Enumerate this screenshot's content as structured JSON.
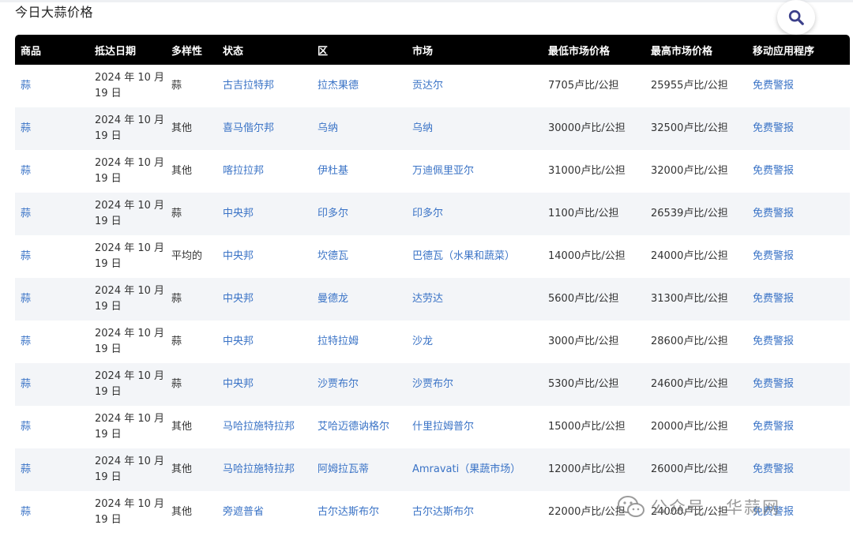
{
  "page": {
    "title": "今日大蒜价格"
  },
  "table": {
    "headers": [
      "商品",
      "抵达日期",
      "多样性",
      "状态",
      "区",
      "市场",
      "最低市场价格",
      "最高市场价格",
      "移动应用程序"
    ],
    "rows": [
      {
        "commodity": "蒜",
        "date": "2024 年 10 月 19 日",
        "variety": "蒜",
        "state": "古吉拉特邦",
        "district": "拉杰果德",
        "market": "贡达尔",
        "min_price": "7705卢比/公担",
        "max_price": "25955卢比/公担",
        "app": "免费警报"
      },
      {
        "commodity": "蒜",
        "date": "2024 年 10 月 19 日",
        "variety": "其他",
        "state": "喜马偕尔邦",
        "district": "乌纳",
        "market": "乌纳",
        "min_price": "30000卢比/公担",
        "max_price": "32500卢比/公担",
        "app": "免费警报"
      },
      {
        "commodity": "蒜",
        "date": "2024 年 10 月 19 日",
        "variety": "其他",
        "state": "喀拉拉邦",
        "district": "伊杜基",
        "market": "万迪佩里亚尔",
        "min_price": "31000卢比/公担",
        "max_price": "32000卢比/公担",
        "app": "免费警报"
      },
      {
        "commodity": "蒜",
        "date": "2024 年 10 月 19 日",
        "variety": "蒜",
        "state": "中央邦",
        "district": "印多尔",
        "market": "印多尔",
        "min_price": "1100卢比/公担",
        "max_price": "26539卢比/公担",
        "app": "免费警报"
      },
      {
        "commodity": "蒜",
        "date": "2024 年 10 月 19 日",
        "variety": "平均的",
        "state": "中央邦",
        "district": "坎德瓦",
        "market": "巴德瓦（水果和蔬菜）",
        "min_price": "14000卢比/公担",
        "max_price": "24000卢比/公担",
        "app": "免费警报"
      },
      {
        "commodity": "蒜",
        "date": "2024 年 10 月 19 日",
        "variety": "蒜",
        "state": "中央邦",
        "district": "曼德龙",
        "market": "达劳达",
        "min_price": "5600卢比/公担",
        "max_price": "31300卢比/公担",
        "app": "免费警报"
      },
      {
        "commodity": "蒜",
        "date": "2024 年 10 月 19 日",
        "variety": "蒜",
        "state": "中央邦",
        "district": "拉特拉姆",
        "market": "沙龙",
        "min_price": "3000卢比/公担",
        "max_price": "28600卢比/公担",
        "app": "免费警报"
      },
      {
        "commodity": "蒜",
        "date": "2024 年 10 月 19 日",
        "variety": "蒜",
        "state": "中央邦",
        "district": "沙贾布尔",
        "market": "沙贾布尔",
        "min_price": "5300卢比/公担",
        "max_price": "24600卢比/公担",
        "app": "免费警报"
      },
      {
        "commodity": "蒜",
        "date": "2024 年 10 月 19 日",
        "variety": "其他",
        "state": "马哈拉施特拉邦",
        "district": "艾哈迈德讷格尔",
        "market": "什里拉姆普尔",
        "min_price": "15000卢比/公担",
        "max_price": "20000卢比/公担",
        "app": "免费警报"
      },
      {
        "commodity": "蒜",
        "date": "2024 年 10 月 19 日",
        "variety": "其他",
        "state": "马哈拉施特拉邦",
        "district": "阿姆拉瓦蒂",
        "market": "Amravati（果蔬市场）",
        "min_price": "12000卢比/公担",
        "max_price": "26000卢比/公担",
        "app": "免费警报"
      },
      {
        "commodity": "蒜",
        "date": "2024 年 10 月 19 日",
        "variety": "其他",
        "state": "旁遮普省",
        "district": "古尔达斯布尔",
        "market": "古尔达斯布尔",
        "min_price": "22000卢比/公担",
        "max_price": "24000卢比/公担",
        "app": "免费警报"
      }
    ]
  },
  "watermark": {
    "text": "公众号 · 华蒜网"
  },
  "icons": {
    "search": "search-icon",
    "wechat": "wechat-icon"
  },
  "colors": {
    "link": "#3a73c6",
    "header_bg": "#000000",
    "stripe": "#f3f5f8"
  }
}
